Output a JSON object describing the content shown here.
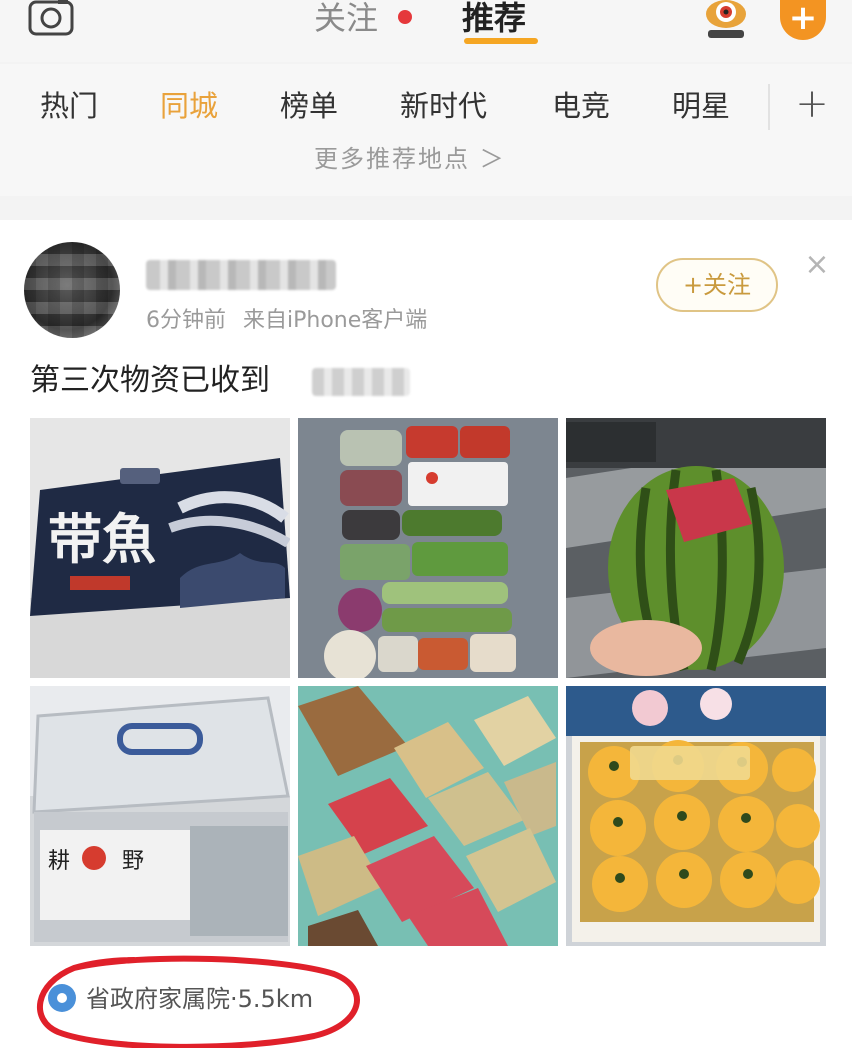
{
  "top_bar": {
    "follow_tab": "关注",
    "recommend_tab": "推荐",
    "add_icon": "plus-icon",
    "camera_icon": "camera-icon",
    "accent_color": "#f39422"
  },
  "channels": {
    "items": [
      "热门",
      "同城",
      "榜单",
      "新时代",
      "电竞",
      "明星"
    ],
    "active": "同城",
    "more_places": "更多推荐地点 ＞",
    "active_color": "#e9a23b"
  },
  "post": {
    "time": "6分钟前",
    "source": "来自iPhone客户端",
    "follow_button": "+关注",
    "close_icon": "close-icon",
    "text": "第三次物资已收到",
    "images": [
      {
        "name": "hairtail-fish-gift-box"
      },
      {
        "name": "packaged-vegetables"
      },
      {
        "name": "watermelon"
      },
      {
        "name": "plastic-storage-box"
      },
      {
        "name": "mooncake-style-boxes"
      },
      {
        "name": "orange-fruit-box"
      }
    ],
    "location": "省政府家属院·5.5km",
    "location_icon": "location-pin-icon"
  }
}
